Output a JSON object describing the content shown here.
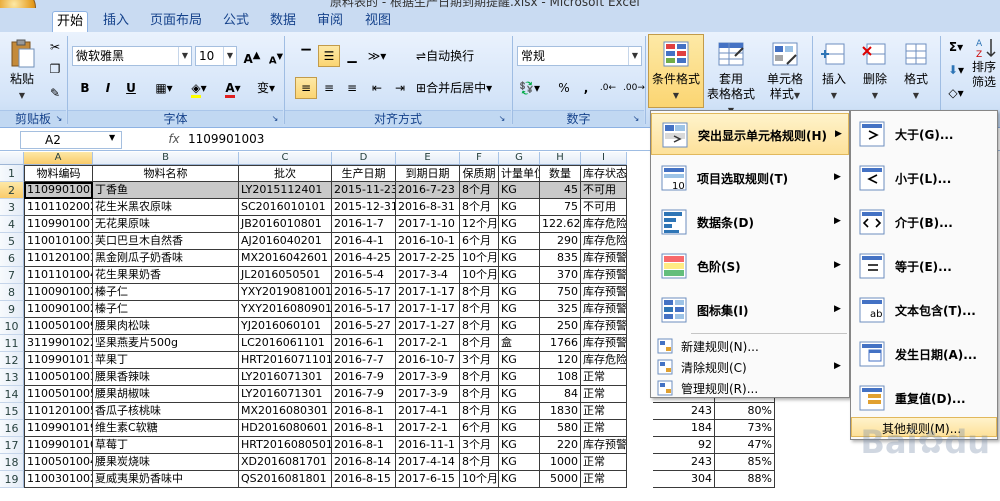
{
  "window": {
    "title": "原料表的 - 根据生产日期到期提醒.xlsx - Microsoft Excel"
  },
  "tabs": [
    "开始",
    "插入",
    "页面布局",
    "公式",
    "数据",
    "审阅",
    "视图"
  ],
  "ribbon": {
    "clipboard": {
      "label": "剪贴板",
      "paste": "粘贴"
    },
    "font": {
      "label": "字体",
      "name": "微软雅黑",
      "size": "10",
      "bold": "B",
      "italic": "I",
      "underline": "U",
      "grow": "A",
      "shrink": "A",
      "phonetic": "变"
    },
    "alignment": {
      "label": "对齐方式",
      "wrap": "自动换行",
      "merge": "合并后居中"
    },
    "number": {
      "label": "数字",
      "format": "常规",
      "percent": "%",
      "comma": ","
    },
    "styles": {
      "conditional": "条件格式",
      "table_line1": "套用",
      "table_line2": "表格格式",
      "cell_line1": "单元格",
      "cell_line2": "样式"
    },
    "cells": {
      "insert": "插入",
      "delete": "删除",
      "format": "格式"
    },
    "editing": {
      "sort_line1": "排序",
      "sort_line2": "筛选",
      "sigma": "Σ"
    }
  },
  "formula_bar": {
    "name_box": "A2",
    "fx": "fx",
    "value": "1109901003"
  },
  "columns": [
    "A",
    "B",
    "C",
    "D",
    "E",
    "F",
    "G",
    "H",
    "I"
  ],
  "sheet": {
    "headers": [
      "物料编码",
      "物料名称",
      "批次",
      "生产日期",
      "到期日期",
      "保质期",
      "计量单位",
      "数量",
      "库存状态"
    ],
    "rows": [
      [
        "1109901003",
        "丁香鱼",
        "LY2015112401",
        "2015-11-23",
        "2016-7-23",
        "8个月",
        "KG",
        "45",
        "不可用"
      ],
      [
        "1101102002",
        "花生米黑农原味",
        "SC2016010101",
        "2015-12-31",
        "2016-8-31",
        "8个月",
        "KG",
        "75",
        "不可用"
      ],
      [
        "1109901007",
        "无花果原味",
        "JB2016010801",
        "2016-1-7",
        "2017-1-10",
        "12个月",
        "KG",
        "122.62",
        "库存危险"
      ],
      [
        "1100101003",
        "芙口巴旦木自然香",
        "AJ2016040201",
        "2016-4-1",
        "2016-10-1",
        "6个月",
        "KG",
        "290",
        "库存危险"
      ],
      [
        "1101201003",
        "黑金刚瓜子奶香味",
        "MX2016042601",
        "2016-4-25",
        "2017-2-25",
        "10个月",
        "KG",
        "835",
        "库存预警"
      ],
      [
        "1101101004",
        "花生果果奶香",
        "JL2016050501",
        "2016-5-4",
        "2017-3-4",
        "10个月",
        "KG",
        "370",
        "库存预警"
      ],
      [
        "1100901002",
        "榛子仁",
        "YXY2019081001",
        "2016-5-17",
        "2017-1-17",
        "8个月",
        "KG",
        "750",
        "库存预警"
      ],
      [
        "1100901002",
        "榛子仁",
        "YXY2016080901",
        "2016-5-17",
        "2017-1-17",
        "8个月",
        "KG",
        "325",
        "库存预警"
      ],
      [
        "1100501009",
        "腰果肉松味",
        "YJ2016060101",
        "2016-5-27",
        "2017-1-27",
        "8个月",
        "KG",
        "250",
        "库存预警"
      ],
      [
        "3119901022",
        "坚果燕麦片500g",
        "LC2016061101",
        "2016-6-1",
        "2017-2-1",
        "8个月",
        "盒",
        "1766",
        "库存预警"
      ],
      [
        "1109901011",
        "苹果丁",
        "HRT2016071101",
        "2016-7-7",
        "2016-10-7",
        "3个月",
        "KG",
        "120",
        "库存危险"
      ],
      [
        "1100501003",
        "腰果香辣味",
        "LY2016071301",
        "2016-7-9",
        "2017-3-9",
        "8个月",
        "KG",
        "108",
        "正常"
      ],
      [
        "1100501005",
        "腰果胡椒味",
        "LY2016071301",
        "2016-7-9",
        "2017-3-9",
        "8个月",
        "KG",
        "84",
        "正常"
      ],
      [
        "1101201005",
        "香瓜子核桃味",
        "MX2016080301",
        "2016-8-1",
        "2017-4-1",
        "8个月",
        "KG",
        "1830",
        "正常"
      ],
      [
        "1109901019",
        "维生素C软糖",
        "HD2016080601",
        "2016-8-1",
        "2017-2-1",
        "6个月",
        "KG",
        "580",
        "正常"
      ],
      [
        "1109901010",
        "草莓丁",
        "HRT2016080501",
        "2016-8-1",
        "2016-11-1",
        "3个月",
        "KG",
        "220",
        "库存预警"
      ],
      [
        "1100501004",
        "腰果炭烧味",
        "XD2016081701",
        "2016-8-14",
        "2017-4-14",
        "8个月",
        "KG",
        "1000",
        "正常"
      ],
      [
        "1100301002",
        "夏威夷果奶香味中",
        "QS2016081801",
        "2016-8-15",
        "2017-6-15",
        "10个月",
        "KG",
        "5000",
        "正常"
      ]
    ],
    "extra_cols": [
      [
        "",
        ""
      ],
      [
        "",
        ""
      ],
      [
        "",
        ""
      ],
      [
        "",
        ""
      ],
      [
        "",
        ""
      ],
      [
        "",
        ""
      ],
      [
        "",
        ""
      ],
      [
        "",
        ""
      ],
      [
        "",
        ""
      ],
      [
        "",
        ""
      ],
      [
        "",
        ""
      ],
      [
        "",
        ""
      ],
      [
        "",
        ""
      ],
      [
        "243",
        "80%"
      ],
      [
        "184",
        "73%"
      ],
      [
        "92",
        "47%"
      ],
      [
        "243",
        "85%"
      ],
      [
        "304",
        "88%"
      ]
    ]
  },
  "menu_main": {
    "items": [
      {
        "label": "突出显示单元格规则(H)",
        "icon": "highlight-cells-icon",
        "submenu": true
      },
      {
        "label": "项目选取规则(T)",
        "icon": "top-bottom-icon",
        "submenu": true
      },
      {
        "label": "数据条(D)",
        "icon": "data-bars-icon",
        "submenu": true
      },
      {
        "label": "色阶(S)",
        "icon": "color-scales-icon",
        "submenu": true
      },
      {
        "label": "图标集(I)",
        "icon": "icon-sets-icon",
        "submenu": true
      }
    ],
    "small_items": [
      {
        "label": "新建规则(N)...",
        "submenu": false
      },
      {
        "label": "清除规则(C)",
        "submenu": true
      },
      {
        "label": "管理规则(R)...",
        "submenu": false
      }
    ]
  },
  "menu_sub": {
    "items": [
      {
        "label": "大于(G)...",
        "icon": "greater-than-icon"
      },
      {
        "label": "小于(L)...",
        "icon": "less-than-icon"
      },
      {
        "label": "介于(B)...",
        "icon": "between-icon"
      },
      {
        "label": "等于(E)...",
        "icon": "equal-to-icon"
      },
      {
        "label": "文本包含(T)...",
        "icon": "text-contains-icon"
      },
      {
        "label": "发生日期(A)...",
        "icon": "date-occurring-icon"
      },
      {
        "label": "重复值(D)...",
        "icon": "duplicate-values-icon"
      }
    ],
    "more": "其他规则(M)..."
  },
  "watermark": "Baidu 经验",
  "colors": {
    "accent": "#fbd572",
    "ribbon": "#d4e4f8",
    "selection": "#c9c9c9"
  }
}
